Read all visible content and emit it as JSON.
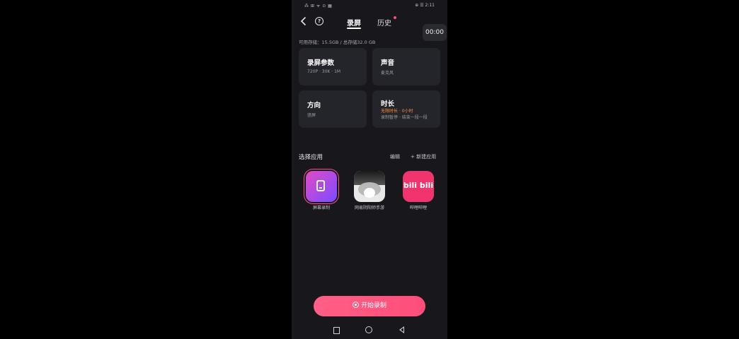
{
  "status_bar": {
    "left": "⁂ ⊞ ᯤ ⊙ ▦",
    "right": "⊕ ☰ 2:11"
  },
  "header": {
    "tabs": [
      {
        "label": "录屏"
      },
      {
        "label": "历史"
      }
    ]
  },
  "timer": "00:00",
  "storage_text": "可用存储：15.5GB / 总存储32.0 GB",
  "settings_cards": [
    {
      "title": "录屏参数",
      "value": "720P · 30K · 1M"
    },
    {
      "title": "声音",
      "value": "麦克风"
    },
    {
      "title": "方向",
      "value": "竖屏"
    },
    {
      "title": "时长",
      "value_line1": "无限时长 · 0小时",
      "value_line2": "录制暂停 · 结束一段一段"
    }
  ],
  "apps_section": {
    "title": "选择应用",
    "edit_label": "编辑",
    "new_label": "+ 新建应用",
    "apps": [
      {
        "name": "屏幕录制",
        "icon": "screen-record-icon"
      },
      {
        "name": "网易阴阳师手游",
        "icon": "game-icon"
      },
      {
        "name": "哔哩哔哩",
        "icon": "bilibili-icon",
        "icon_text": "bili bili"
      }
    ]
  },
  "record_button": {
    "label": "开始录制"
  },
  "colors": {
    "accent": "#ff4d7a",
    "card_bg": "#24242b",
    "phone_bg": "#17171c"
  }
}
